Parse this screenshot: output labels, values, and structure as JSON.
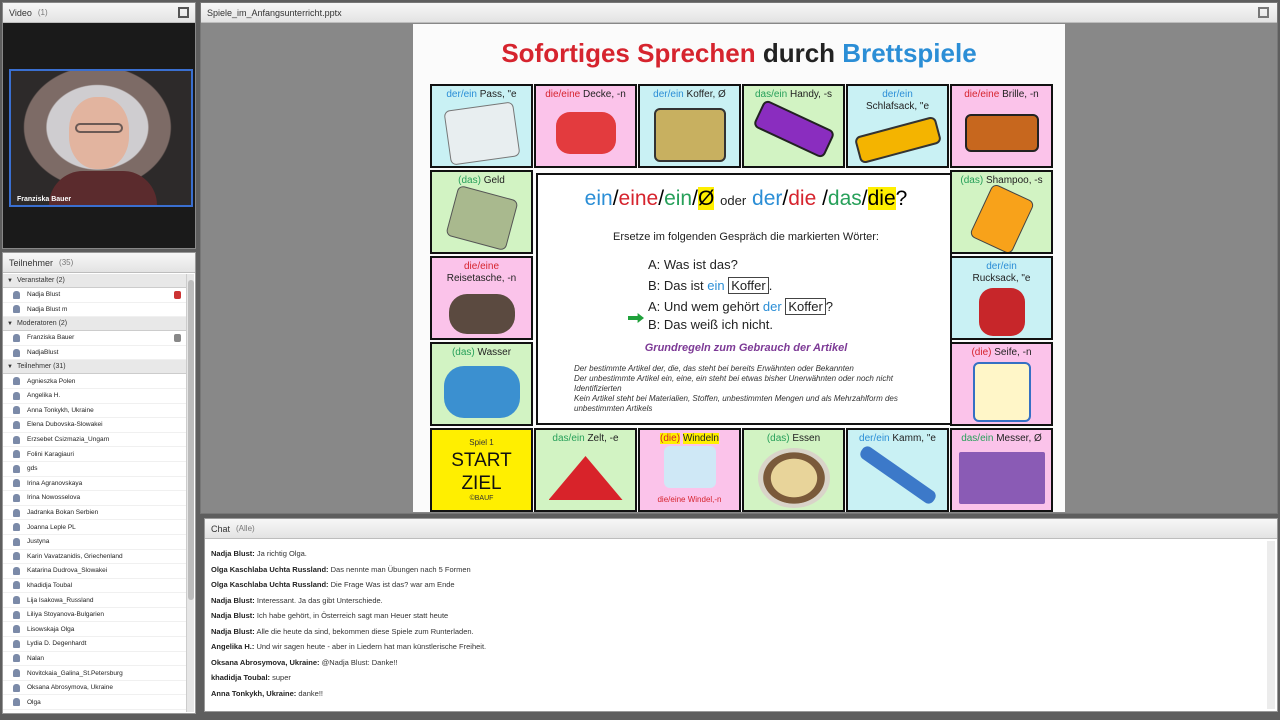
{
  "video": {
    "title": "Video",
    "count": "(1)",
    "presenter": "Franziska Bauer"
  },
  "attendees": {
    "title": "Teilnehmer",
    "count": "(35)",
    "hosts_label": "Veranstalter (2)",
    "hosts": [
      "Nadja Blust",
      "Nadja Blust m"
    ],
    "presenters_label": "Moderatoren (2)",
    "presenters": [
      "Franziska Bauer",
      "NadjaBlust"
    ],
    "participants_label": "Teilnehmer (31)",
    "participants": [
      "Agnieszka Polen",
      "Angelika H.",
      "Anna Tonkykh, Ukraine",
      "Elena Dubovska-Slowakei",
      "Erzsebet Csizmazia_Ungarn",
      "Folini Karagiauri",
      "gds",
      "Irina Agranovskaya",
      "Irina Nowosselova",
      "Jadranka Bokan Serbien",
      "Joanna Leple PL",
      "Justyna",
      "Karin Vavatzanidis, Griechenland",
      "Katarina Dudrova_Slowakei",
      "khadidja Toubal",
      "Lija Isakowa_Russland",
      "Liliya Stoyanova-Bulgarien",
      "Lisowskaja Olga",
      "Lydia D. Degenhardt",
      "Nalan",
      "Novitckaia_Galina_St.Petersburg",
      "Oksana Abrosymova, Ukraine",
      "Olga"
    ]
  },
  "share": {
    "filename": "Spiele_im_Anfangsunterricht.pptx"
  },
  "slide": {
    "title_part1": "Sofortiges Sprechen",
    "title_part2": "durch",
    "title_part3": "Brettspiele",
    "cells": {
      "pass": {
        "art": "der/ein",
        "noun": "Pass, \"e"
      },
      "decke": {
        "art": "die/eine",
        "noun": "Decke, -n"
      },
      "koffer": {
        "art": "der/ein",
        "noun": "Koffer, Ø"
      },
      "handy": {
        "art": "das/ein",
        "noun": "Handy, -s"
      },
      "schlafsack": {
        "art": "der/ein",
        "noun": "Schlafsack, \"e"
      },
      "brille": {
        "art": "die/eine",
        "noun": "Brille, -n"
      },
      "geld": {
        "art": "(das)",
        "noun": "Geld"
      },
      "shampoo": {
        "art": "(das)",
        "noun": "Shampoo, -s"
      },
      "reisetasche": {
        "art": "die/eine",
        "noun": "Reisetasche, -n"
      },
      "rucksack": {
        "art": "der/ein",
        "noun": "Rucksack, \"e"
      },
      "wasser": {
        "art": "(das)",
        "noun": "Wasser"
      },
      "seife": {
        "art": "(die)",
        "noun": "Seife, -n"
      },
      "zelt": {
        "art": "das/ein",
        "noun": "Zelt, -e"
      },
      "windeln": {
        "art": "(die)",
        "noun": "Windeln",
        "extra": "die/eine Windel,-n"
      },
      "essen": {
        "art": "(das)",
        "noun": "Essen"
      },
      "kamm": {
        "art": "der/ein",
        "noun": "Kamm, \"e"
      },
      "messer": {
        "art": "das/ein",
        "noun": "Messer, Ø"
      }
    },
    "start": {
      "game": "Spiel 1",
      "start": "START",
      "ziel": "ZIEL",
      "copyright": "©BAUF"
    },
    "center": {
      "h1": "ein",
      "h2": "eine",
      "h3": "ein",
      "h4": "Ø",
      "oder": "oder",
      "h5": "der",
      "h6": "die",
      "h7": "das",
      "h8": "die",
      "q": "?",
      "instruction": "Ersetze im folgenden Gespräch die markierten Wörter:",
      "l1": "A:  Was ist das?",
      "l2a": "B:  Das ist",
      "l2b": "ein",
      "l2c": "Koffer",
      "l3a": "A:  Und wem gehört",
      "l3b": "der",
      "l3c": "Koffer",
      "l4": "B:  Das weiß ich nicht.",
      "rules_title": "Grundregeln zum Gebrauch der Artikel",
      "rule1": "Der bestimmte Artikel der, die, das steht bei bereits Erwähnten oder Bekannten",
      "rule2": "Der unbestimmte Artikel ein, eine, ein steht bei etwas bisher Unerwähnten oder noch nicht Identifizierten",
      "rule3": "Kein Artikel steht bei Materialien, Stoffen, unbestimmten Mengen und als Mehrzahlform des unbestimmten Artikels"
    }
  },
  "chat": {
    "title": "Chat",
    "scope": "(Alle)",
    "messages": [
      {
        "from": "Nadja Blust:",
        "text": "Ja richtig Olga."
      },
      {
        "from": "Olga Kaschlaba Uchta Russland:",
        "text": "Das nennte man Übungen nach 5 Formen"
      },
      {
        "from": "Olga Kaschlaba Uchta Russland:",
        "text": "Die Frage Was ist das? war am Ende"
      },
      {
        "from": "Nadja Blust:",
        "text": "Interessant. Ja das gibt Unterschiede."
      },
      {
        "from": "Nadja Blust:",
        "text": "Ich habe gehört, in Österreich sagt man Heuer statt heute"
      },
      {
        "from": "Nadja Blust:",
        "text": "Alle die heute da sind, bekommen diese Spiele zum Runterladen."
      },
      {
        "from": "Angelika H.:",
        "text": "Und wir sagen heute - aber in Liedern hat man  künstlerische Freiheit."
      },
      {
        "from": "Oksana Abrosymova, Ukraine:",
        "text": "@Nadja Blust: Danke!!"
      },
      {
        "from": "khadidja Toubal:",
        "text": "super"
      },
      {
        "from": "Anna Tonkykh, Ukraine:",
        "text": "danke!!"
      }
    ]
  }
}
